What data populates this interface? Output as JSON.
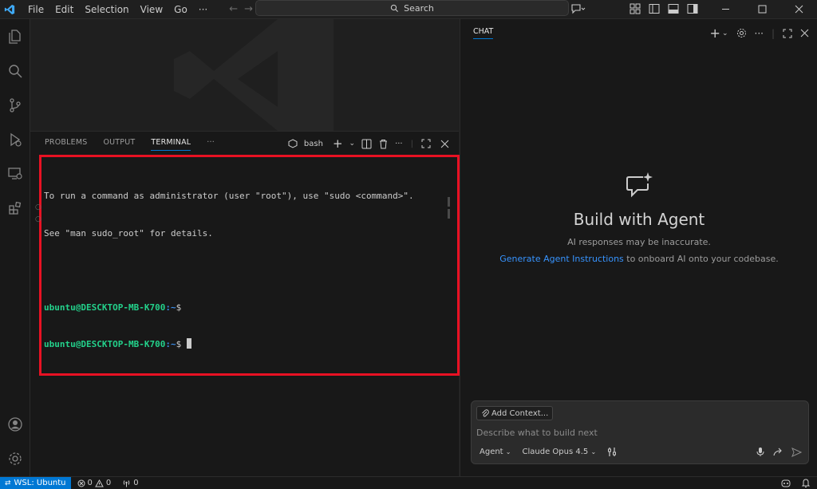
{
  "titlebar": {
    "menu": [
      "File",
      "Edit",
      "Selection",
      "View",
      "Go",
      "···"
    ],
    "search": "Search"
  },
  "panel": {
    "tabs": [
      "PROBLEMS",
      "OUTPUT",
      "TERMINAL",
      "···"
    ],
    "shell_label": "bash"
  },
  "terminal": {
    "line1": "To run a command as administrator (user \"root\"), use \"sudo <command>\".",
    "line2": "See \"man sudo_root\" for details.",
    "prompt_user": "ubuntu@DESCKTOP-MB-K700",
    "prompt_path": ":~",
    "prompt_symbol": "$"
  },
  "chat": {
    "title": "CHAT",
    "heading": "Build with Agent",
    "subtitle": "AI responses may be inaccurate.",
    "link": "Generate Agent Instructions",
    "link_suffix": " to onboard AI onto your codebase.",
    "add_context": "Add Context...",
    "placeholder": "Describe what to build next",
    "mode": "Agent",
    "model": "Claude Opus 4.5"
  },
  "statusbar": {
    "remote": "WSL: Ubuntu",
    "errors": "0",
    "warnings": "0",
    "ports": "0"
  },
  "colors": {
    "accent": "#0078d4",
    "highlight": "#e81123",
    "prompt_green": "#23d18b",
    "prompt_blue": "#3b8eea",
    "link": "#3794ff"
  }
}
